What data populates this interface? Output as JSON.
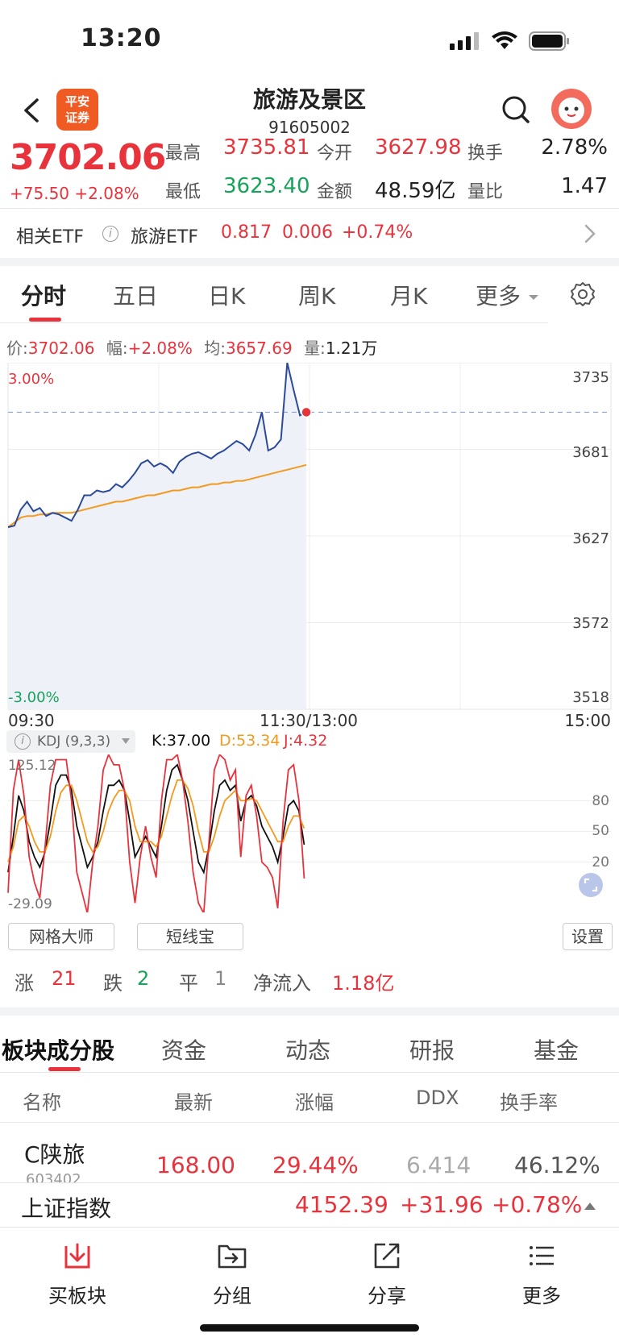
{
  "status": {
    "time": "13:20"
  },
  "header": {
    "brand_line1": "平安",
    "brand_line2": "证券",
    "title": "旅游及景区",
    "code": "91605002"
  },
  "quote": {
    "price": "3702.06",
    "change": "+75.50",
    "change_pct": "+2.08%",
    "high_label": "最高",
    "high": "3735.81",
    "open_label": "今开",
    "open": "3627.98",
    "turnover_label": "换手",
    "turnover": "2.78%",
    "low_label": "最低",
    "low": "3623.40",
    "amount_label": "金额",
    "amount": "48.59亿",
    "vol_ratio_label": "量比",
    "vol_ratio": "1.47"
  },
  "etf": {
    "label": "相关ETF",
    "name": "旅游ETF",
    "price": "0.817",
    "change": "0.006",
    "pct": "+0.74%"
  },
  "period_tabs": [
    "分时",
    "五日",
    "日K",
    "周K",
    "月K",
    "更多"
  ],
  "chart_info": {
    "price_label": "价:",
    "price": "3702.06",
    "pct_label": "幅:",
    "pct": "+2.08%",
    "avg_label": "均:",
    "avg": "3657.69",
    "vol_label": "量:",
    "vol": "1.21万"
  },
  "chart_data": [
    {
      "type": "line",
      "y_axis_right": [
        "3735",
        "3681",
        "3627",
        "3572",
        "3518"
      ],
      "y_axis_left": {
        "top": "3.00%",
        "bottom": "-3.00%"
      },
      "x_ticks": [
        "09:30",
        "11:30/13:00",
        "15:00"
      ],
      "ylim": [
        3518,
        3735
      ],
      "reference": 3627,
      "series": [
        {
          "values": [
            3632,
            3633,
            3643,
            3648,
            3642,
            3644,
            3639,
            3641,
            3640,
            3638,
            3636,
            3643,
            3652,
            3652,
            3655,
            3654,
            3655,
            3659,
            3657,
            3661,
            3666,
            3672,
            3674,
            3670,
            3672,
            3670,
            3666,
            3673,
            3676,
            3678,
            3679,
            3677,
            3675,
            3678,
            3680,
            3683,
            3686,
            3684,
            3680,
            3690,
            3704,
            3680,
            3682,
            3687,
            3735,
            3718,
            3702,
            3704
          ]
        },
        {
          "values": [
            3632,
            3635,
            3638,
            3639,
            3639,
            3640,
            3640,
            3641,
            3641,
            3641,
            3641,
            3642,
            3643,
            3644,
            3645,
            3646,
            3647,
            3648,
            3648,
            3649,
            3650,
            3651,
            3652,
            3652,
            3653,
            3654,
            3655,
            3655,
            3656,
            3657,
            3657,
            3658,
            3659,
            3659,
            3660,
            3660,
            3661,
            3661,
            3662,
            3663,
            3664,
            3665,
            3666,
            3667,
            3668,
            3669,
            3670,
            3671
          ]
        }
      ]
    },
    {
      "type": "line",
      "indicator_name": "KDJ (9,3,3)",
      "k_label": "K:37.00",
      "d_label": "D:53.34",
      "j_label": "J:4.32",
      "y_top_label": "125.12",
      "y_bottom_label": "-29.09",
      "y_axis_right": [
        "80",
        "50",
        "20"
      ],
      "ylim": [
        -29.09,
        125.12
      ],
      "series": [
        {
          "name": "K",
          "values": [
            10,
            45,
            85,
            70,
            40,
            25,
            15,
            30,
            60,
            95,
            105,
            105,
            90,
            55,
            35,
            15,
            25,
            40,
            70,
            95,
            95,
            100,
            90,
            60,
            25,
            35,
            45,
            35,
            25,
            55,
            90,
            110,
            115,
            100,
            80,
            50,
            20,
            10,
            35,
            70,
            95,
            100,
            90,
            95,
            60,
            80,
            85,
            75,
            55,
            45,
            35,
            20,
            45,
            75,
            80,
            70,
            37
          ]
        },
        {
          "name": "D",
          "values": [
            20,
            35,
            60,
            65,
            55,
            40,
            30,
            30,
            45,
            70,
            88,
            95,
            95,
            80,
            60,
            40,
            30,
            35,
            50,
            70,
            82,
            90,
            90,
            80,
            55,
            40,
            40,
            40,
            35,
            45,
            65,
            85,
            100,
            100,
            92,
            75,
            50,
            30,
            30,
            45,
            65,
            80,
            85,
            90,
            80,
            80,
            82,
            80,
            70,
            60,
            50,
            40,
            40,
            55,
            65,
            65,
            53
          ]
        },
        {
          "name": "J",
          "values": [
            -10,
            90,
            120,
            85,
            25,
            0,
            -15,
            35,
            95,
            120,
            120,
            120,
            80,
            10,
            -10,
            -30,
            20,
            55,
            110,
            125,
            115,
            115,
            90,
            20,
            -20,
            25,
            55,
            25,
            5,
            80,
            120,
            120,
            125,
            100,
            60,
            10,
            -20,
            -30,
            40,
            110,
            125,
            120,
            100,
            110,
            25,
            85,
            95,
            65,
            20,
            15,
            5,
            -25,
            60,
            110,
            115,
            80,
            4
          ]
        }
      ]
    }
  ],
  "tools": {
    "grid_master": "网格大师",
    "short_line": "短线宝",
    "settings": "设置"
  },
  "stats": {
    "up_label": "涨",
    "up": "21",
    "down_label": "跌",
    "down": "2",
    "flat_label": "平",
    "flat": "1",
    "inflow_label": "净流入",
    "inflow": "1.18亿"
  },
  "sub_tabs": [
    "板块成分股",
    "资金",
    "动态",
    "研报",
    "基金"
  ],
  "table": {
    "headers": [
      "名称",
      "最新",
      "涨幅",
      "DDX",
      "换手率"
    ],
    "rows": [
      {
        "name": "C陕旅",
        "code": "603402",
        "latest": "168.00",
        "pct": "29.44%",
        "ddx": "6.414",
        "turnover": "46.12%"
      }
    ]
  },
  "index_bar": {
    "name": "上证指数",
    "value": "4152.39",
    "change": "+31.96",
    "pct": "+0.78%"
  },
  "toolbar": {
    "buy": "买板块",
    "group": "分组",
    "share": "分享",
    "more": "更多"
  },
  "colors": {
    "red": "#e8333c",
    "green": "#18a35b",
    "blue_line": "#2b4a9a",
    "avg_line": "#f39a1e"
  }
}
